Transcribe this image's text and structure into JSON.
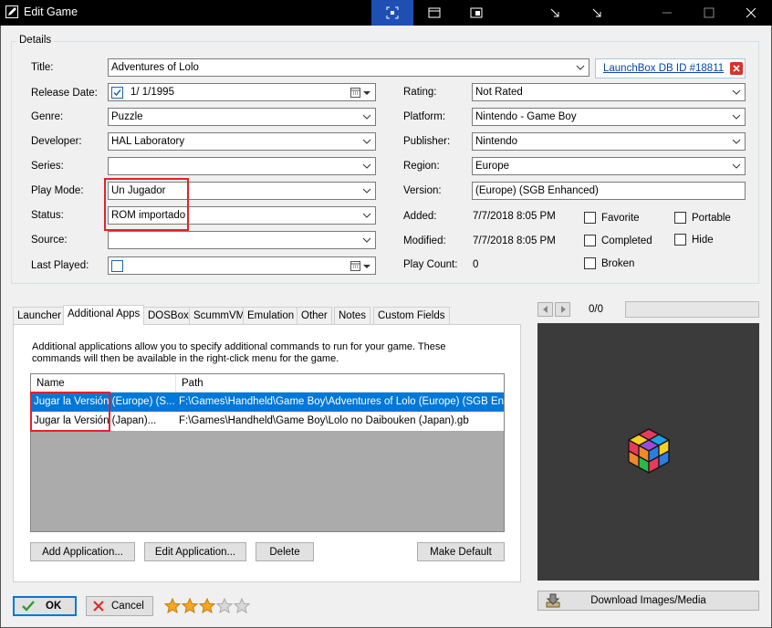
{
  "window": {
    "title": "Edit Game"
  },
  "details": {
    "group_label": "Details",
    "title_label": "Title:",
    "title_value": "Adventures of Lolo",
    "db_link": "LaunchBox DB ID #18811",
    "release_date_label": "Release Date:",
    "release_date_value": "1/  1/1995",
    "genre_label": "Genre:",
    "genre_value": "Puzzle",
    "developer_label": "Developer:",
    "developer_value": "HAL Laboratory",
    "series_label": "Series:",
    "series_value": "",
    "play_mode_label": "Play Mode:",
    "play_mode_value": "Un Jugador",
    "status_label": "Status:",
    "status_value": "ROM importado",
    "source_label": "Source:",
    "source_value": "",
    "last_played_label": "Last Played:",
    "rating_label": "Rating:",
    "rating_value": "Not Rated",
    "platform_label": "Platform:",
    "platform_value": "Nintendo - Game Boy",
    "publisher_label": "Publisher:",
    "publisher_value": "Nintendo",
    "region_label": "Region:",
    "region_value": "Europe",
    "version_label": "Version:",
    "version_value": "(Europe) (SGB Enhanced)",
    "added_label": "Added:",
    "added_value": "7/7/2018 8:05 PM",
    "modified_label": "Modified:",
    "modified_value": "7/7/2018 8:05 PM",
    "play_count_label": "Play Count:",
    "play_count_value": "0",
    "checkboxes": {
      "favorite": "Favorite",
      "completed": "Completed",
      "broken": "Broken",
      "portable": "Portable",
      "hide": "Hide"
    }
  },
  "tabs": [
    "Launcher",
    "Additional Apps",
    "DOSBox",
    "ScummVM",
    "Emulation",
    "Other",
    "Notes",
    "Custom Fields"
  ],
  "additional_apps": {
    "description": "Additional applications allow you to specify additional commands to run for your game.  These commands will then be available in the right-click menu for the game.",
    "col_name": "Name",
    "col_path": "Path",
    "rows": [
      {
        "name": "Jugar la Versión (Europe) (S...",
        "path": "F:\\Games\\Handheld\\Game Boy\\Adventures of Lolo (Europe) (SGB Enh..."
      },
      {
        "name": "Jugar la Versión (Japan)...",
        "path": "F:\\Games\\Handheld\\Game Boy\\Lolo no Daibouken (Japan).gb"
      }
    ],
    "add_btn": "Add Application...",
    "edit_btn": "Edit Application...",
    "delete_btn": "Delete",
    "default_btn": "Make Default"
  },
  "media": {
    "counter": "0/0",
    "download_btn": "Download Images/Media"
  },
  "footer": {
    "ok": "OK",
    "cancel": "Cancel",
    "stars": 3,
    "stars_max": 5
  },
  "colors": {
    "accent": "#0078d7",
    "highlight": "#e8202a",
    "star": "#f5a623"
  }
}
